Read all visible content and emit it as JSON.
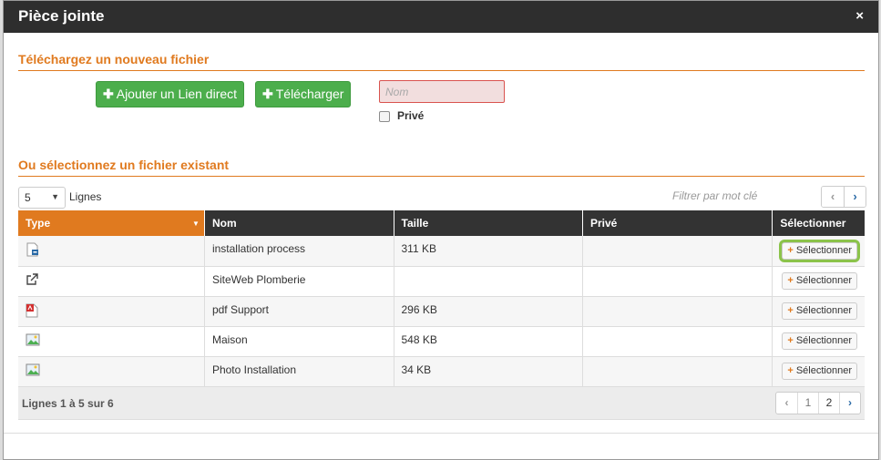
{
  "dialog": {
    "title": "Pièce jointe",
    "close_symbol": "×"
  },
  "upload": {
    "section_title": "Téléchargez un nouveau fichier",
    "add_link_label": "Ajouter un Lien direct",
    "upload_label": "Télécharger",
    "name_placeholder": "Nom",
    "private_label": "Privé"
  },
  "existing": {
    "section_title": "Ou sélectionnez un fichier existant",
    "page_size": "5",
    "page_size_label": "Lignes",
    "filter_label": "Filtrer par mot clé"
  },
  "table": {
    "headers": [
      "Type",
      "Nom",
      "Taille",
      "Privé",
      "Sélectionner"
    ],
    "select_label": "Sélectionner",
    "rows": [
      {
        "icon": "document-icon",
        "name": "installation process",
        "size": "311 KB",
        "private": ""
      },
      {
        "icon": "external-link-icon",
        "name": "SiteWeb Plomberie",
        "size": "",
        "private": ""
      },
      {
        "icon": "pdf-icon",
        "name": "pdf Support",
        "size": "296 KB",
        "private": ""
      },
      {
        "icon": "image-icon",
        "name": "Maison",
        "size": "548 KB",
        "private": ""
      },
      {
        "icon": "image-icon",
        "name": "Photo Installation",
        "size": "34 KB",
        "private": ""
      }
    ]
  },
  "footer": {
    "summary": "Lignes 1 à 5 sur 6",
    "pages": [
      "1",
      "2"
    ]
  },
  "colors": {
    "accent": "#e07a1f",
    "header": "#2e2e2e",
    "green": "#4cae4c",
    "highlight": "#8bc34a"
  }
}
